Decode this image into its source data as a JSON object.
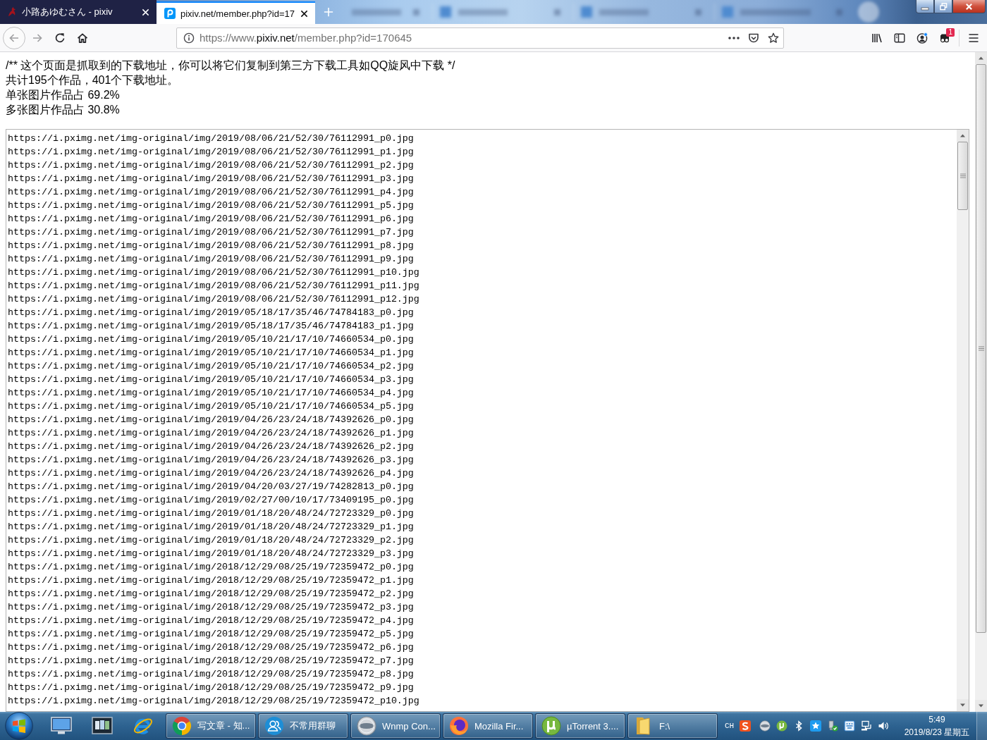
{
  "browser": {
    "tabs": [
      {
        "title": "小路あゆむさん - pixiv",
        "selected": false
      },
      {
        "title": "pixiv.net/member.php?id=17",
        "selected": true
      }
    ],
    "address_bar": {
      "url": "https://www.**pixiv.net**/member.php?id=170645"
    },
    "extension_badge": "1"
  },
  "page": {
    "header_lines": [
      "/** 这个页面是抓取到的下载地址，你可以将它们复制到第三方下载工具如QQ旋风中下载 */",
      "共计195个作品，401个下载地址。",
      "单张图片作品占 69.2%",
      "多张图片作品占 30.8%"
    ],
    "download_links": [
      "https://i.pximg.net/img-original/img/2019/08/06/21/52/30/76112991_p0.jpg",
      "https://i.pximg.net/img-original/img/2019/08/06/21/52/30/76112991_p1.jpg",
      "https://i.pximg.net/img-original/img/2019/08/06/21/52/30/76112991_p2.jpg",
      "https://i.pximg.net/img-original/img/2019/08/06/21/52/30/76112991_p3.jpg",
      "https://i.pximg.net/img-original/img/2019/08/06/21/52/30/76112991_p4.jpg",
      "https://i.pximg.net/img-original/img/2019/08/06/21/52/30/76112991_p5.jpg",
      "https://i.pximg.net/img-original/img/2019/08/06/21/52/30/76112991_p6.jpg",
      "https://i.pximg.net/img-original/img/2019/08/06/21/52/30/76112991_p7.jpg",
      "https://i.pximg.net/img-original/img/2019/08/06/21/52/30/76112991_p8.jpg",
      "https://i.pximg.net/img-original/img/2019/08/06/21/52/30/76112991_p9.jpg",
      "https://i.pximg.net/img-original/img/2019/08/06/21/52/30/76112991_p10.jpg",
      "https://i.pximg.net/img-original/img/2019/08/06/21/52/30/76112991_p11.jpg",
      "https://i.pximg.net/img-original/img/2019/08/06/21/52/30/76112991_p12.jpg",
      "https://i.pximg.net/img-original/img/2019/05/18/17/35/46/74784183_p0.jpg",
      "https://i.pximg.net/img-original/img/2019/05/18/17/35/46/74784183_p1.jpg",
      "https://i.pximg.net/img-original/img/2019/05/10/21/17/10/74660534_p0.jpg",
      "https://i.pximg.net/img-original/img/2019/05/10/21/17/10/74660534_p1.jpg",
      "https://i.pximg.net/img-original/img/2019/05/10/21/17/10/74660534_p2.jpg",
      "https://i.pximg.net/img-original/img/2019/05/10/21/17/10/74660534_p3.jpg",
      "https://i.pximg.net/img-original/img/2019/05/10/21/17/10/74660534_p4.jpg",
      "https://i.pximg.net/img-original/img/2019/05/10/21/17/10/74660534_p5.jpg",
      "https://i.pximg.net/img-original/img/2019/04/26/23/24/18/74392626_p0.jpg",
      "https://i.pximg.net/img-original/img/2019/04/26/23/24/18/74392626_p1.jpg",
      "https://i.pximg.net/img-original/img/2019/04/26/23/24/18/74392626_p2.jpg",
      "https://i.pximg.net/img-original/img/2019/04/26/23/24/18/74392626_p3.jpg",
      "https://i.pximg.net/img-original/img/2019/04/26/23/24/18/74392626_p4.jpg",
      "https://i.pximg.net/img-original/img/2019/04/20/03/27/19/74282813_p0.jpg",
      "https://i.pximg.net/img-original/img/2019/02/27/00/10/17/73409195_p0.jpg",
      "https://i.pximg.net/img-original/img/2019/01/18/20/48/24/72723329_p0.jpg",
      "https://i.pximg.net/img-original/img/2019/01/18/20/48/24/72723329_p1.jpg",
      "https://i.pximg.net/img-original/img/2019/01/18/20/48/24/72723329_p2.jpg",
      "https://i.pximg.net/img-original/img/2019/01/18/20/48/24/72723329_p3.jpg",
      "https://i.pximg.net/img-original/img/2018/12/29/08/25/19/72359472_p0.jpg",
      "https://i.pximg.net/img-original/img/2018/12/29/08/25/19/72359472_p1.jpg",
      "https://i.pximg.net/img-original/img/2018/12/29/08/25/19/72359472_p2.jpg",
      "https://i.pximg.net/img-original/img/2018/12/29/08/25/19/72359472_p3.jpg",
      "https://i.pximg.net/img-original/img/2018/12/29/08/25/19/72359472_p4.jpg",
      "https://i.pximg.net/img-original/img/2018/12/29/08/25/19/72359472_p5.jpg",
      "https://i.pximg.net/img-original/img/2018/12/29/08/25/19/72359472_p6.jpg",
      "https://i.pximg.net/img-original/img/2018/12/29/08/25/19/72359472_p7.jpg",
      "https://i.pximg.net/img-original/img/2018/12/29/08/25/19/72359472_p8.jpg",
      "https://i.pximg.net/img-original/img/2018/12/29/08/25/19/72359472_p9.jpg",
      "https://i.pximg.net/img-original/img/2018/12/29/08/25/19/72359472_p10.jpg"
    ]
  },
  "taskbar": {
    "windows": [
      {
        "label": "写文章 - 知...",
        "kind": "chrome"
      },
      {
        "label": "不常用群聊",
        "kind": "contacts"
      },
      {
        "label": "Wnmp Con...",
        "kind": "wnmp"
      },
      {
        "label": "Mozilla Fir...",
        "kind": "firefox"
      },
      {
        "label": "µTorrent 3....",
        "kind": "utorrent"
      },
      {
        "label": "F:\\",
        "kind": "folder"
      }
    ],
    "tray": {
      "input_language": "CH"
    },
    "clock": {
      "time": "5:49",
      "date": "2019/8/23 星期五"
    }
  }
}
